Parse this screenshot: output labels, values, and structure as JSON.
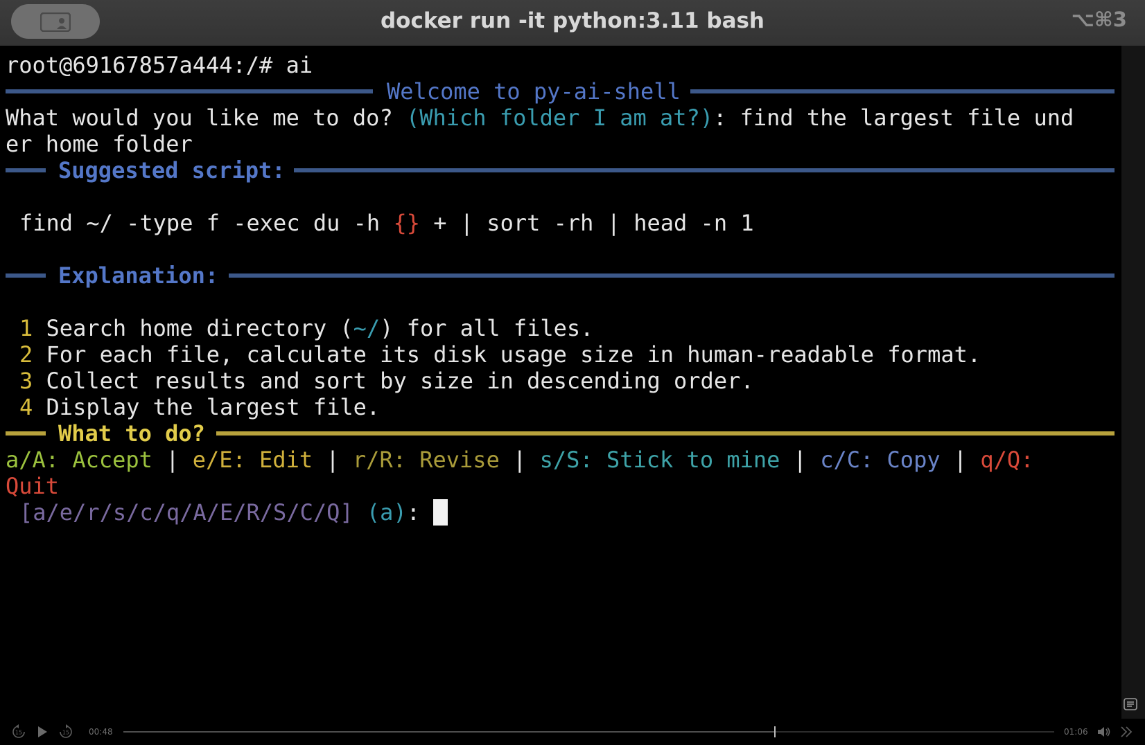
{
  "window": {
    "title": "docker run -it python:3.11 bash",
    "shortcut": "⌥⌘3"
  },
  "terminal": {
    "prompt": "root@69167857a444:/# ai",
    "welcome": "Welcome to py-ai-shell",
    "question": {
      "prefix": "What would you like me to do? ",
      "hint": "(Which folder I am at?)",
      "answer_line1": ": find the largest file und",
      "answer_line2": "er home folder"
    },
    "suggested_script_label": "Suggested script:",
    "script": {
      "before": "find ~/ -type f -exec du -h ",
      "placeholder": "{}",
      "after": " + | sort -rh | head -n 1"
    },
    "explanation_label": "Explanation:",
    "explanation": [
      {
        "num": "1",
        "before": "Search home directory (",
        "hl": "~/",
        "after": ") for all files."
      },
      {
        "num": "2",
        "before": "For each file, calculate its disk usage size in human-readable format.",
        "hl": "",
        "after": ""
      },
      {
        "num": "3",
        "before": "Collect results and sort by size in descending order.",
        "hl": "",
        "after": ""
      },
      {
        "num": "4",
        "before": "Display the largest file.",
        "hl": "",
        "after": ""
      }
    ],
    "what_to_do_label": "What to do?",
    "options": {
      "accept": "a/A: Accept",
      "edit": "e/E: Edit",
      "revise": "r/R: Revise",
      "stick": "s/S: Stick to mine",
      "copy": "c/C: Copy",
      "quit_key": "q/Q:",
      "quit_label": "Quit",
      "separator": " | "
    },
    "choice_prompt": {
      "choices": "[a/e/r/s/c/q/A/E/R/S/C/Q]",
      "default": "(a)",
      "colon": ":"
    }
  },
  "player": {
    "current_time": "00:48",
    "total_time": "01:06",
    "progress": 0.7
  },
  "colors": {
    "rule_blue": "#3c5889",
    "rule_yellow": "#b8a23c",
    "accept": "#9cc23e",
    "edit": "#d1b13c",
    "revise": "#aa9c3a",
    "stick": "#3ea3a8",
    "copy": "#6a84c8",
    "quit": "#d94a3a"
  },
  "icons": {
    "title_pill": "person-screen-icon",
    "rewind": "rewind-15-icon",
    "play": "play-icon",
    "forward": "forward-15-icon",
    "volume": "speaker-icon",
    "fullscreen": "chevron-double-right-icon",
    "fit": "fit-to-screen-icon"
  }
}
